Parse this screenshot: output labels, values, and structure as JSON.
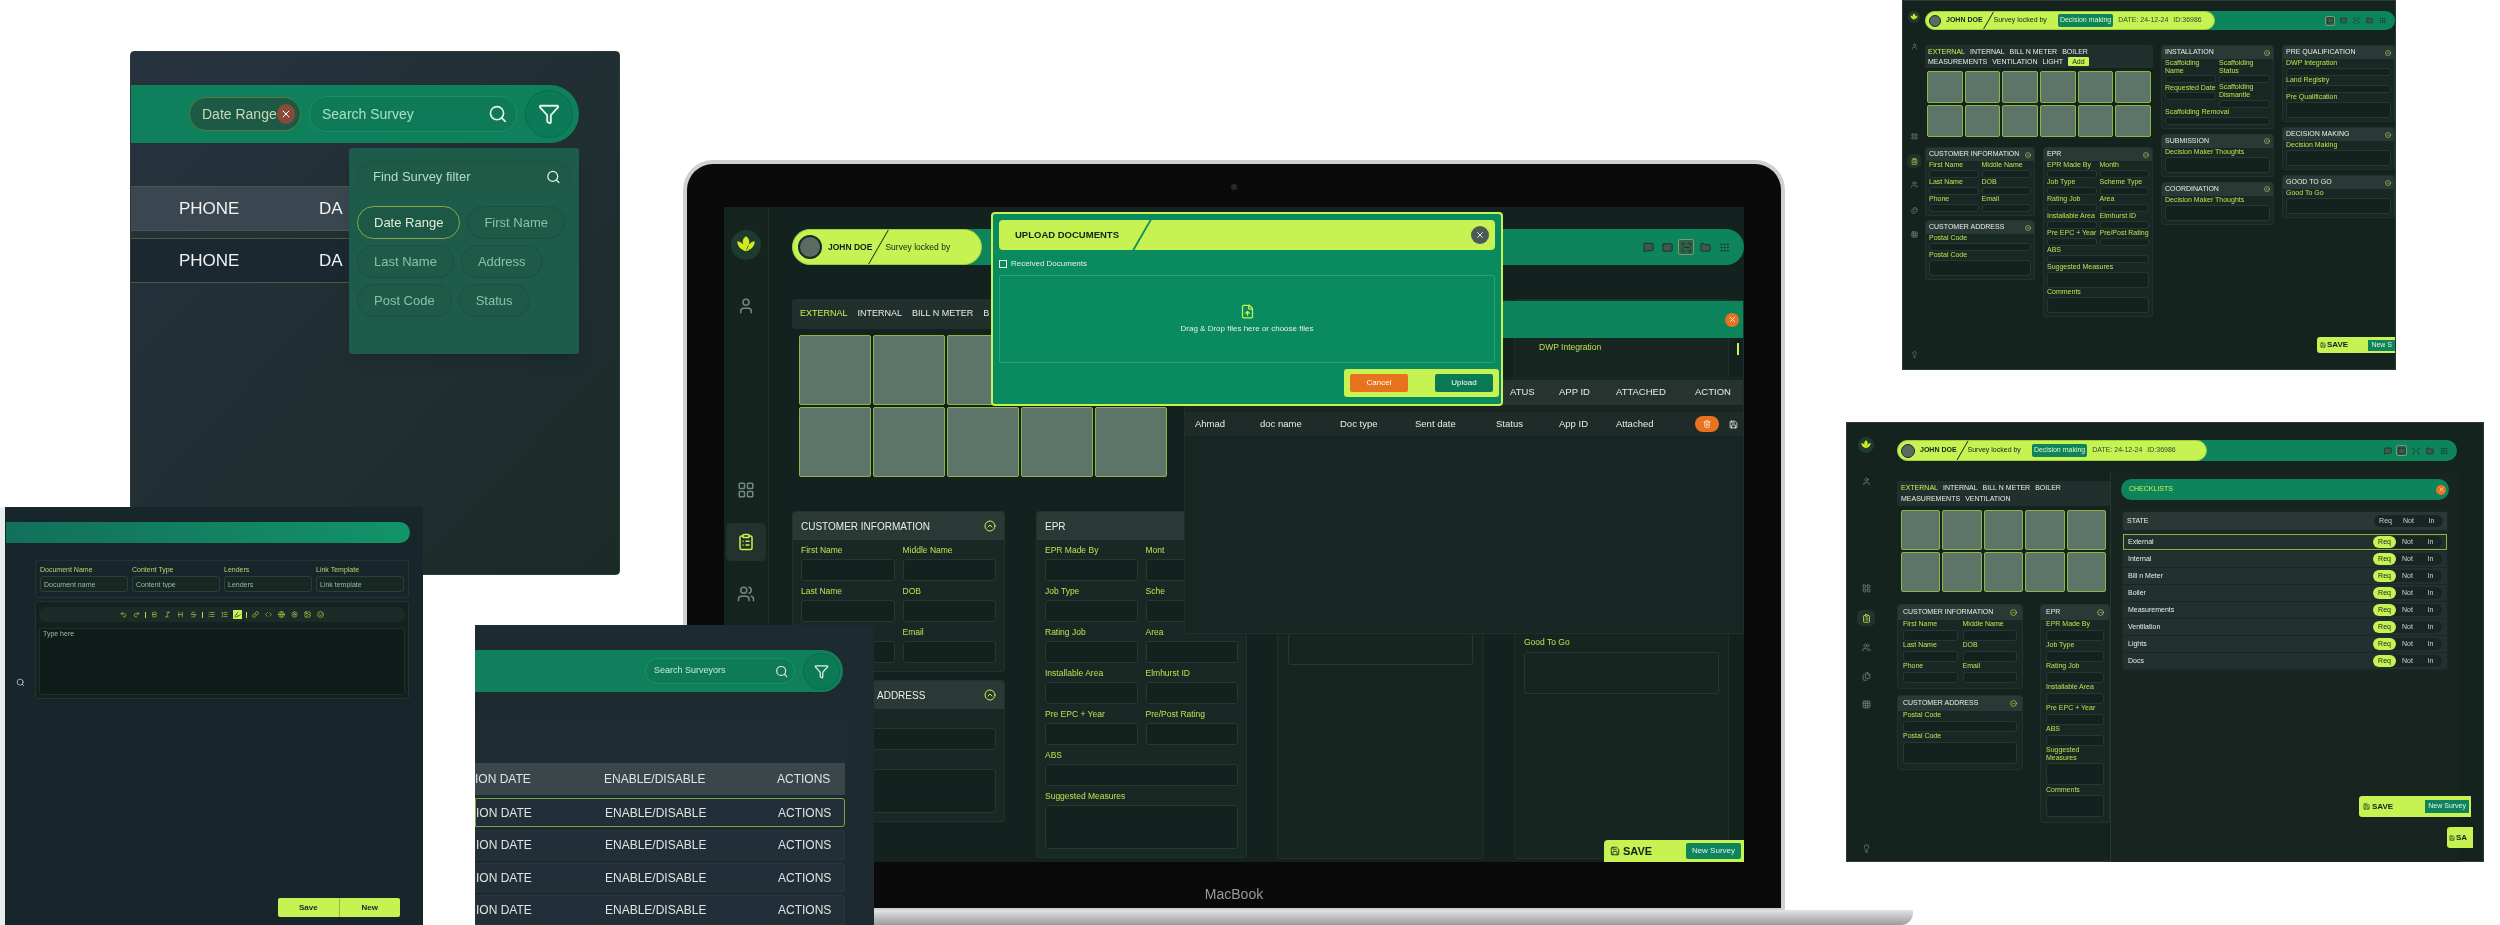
{
  "filter_panel": {
    "chip": "Date Range",
    "search": {
      "placeholder": "Search Survey"
    },
    "rows": [
      {
        "cells": [
          "PHONE",
          "DA"
        ],
        "selected": true
      },
      {
        "cells": [
          "PHONE",
          "DA"
        ],
        "selected": false
      }
    ],
    "dropdown": {
      "search": {
        "placeholder": "Find Survey filter"
      },
      "options": [
        {
          "label": "Date Range",
          "selected": true
        },
        {
          "label": "First Name",
          "selected": false
        },
        {
          "label": "Last Name",
          "selected": false
        },
        {
          "label": "Address",
          "selected": false
        },
        {
          "label": "Post Code",
          "selected": false
        },
        {
          "label": "Status",
          "selected": false
        }
      ]
    }
  },
  "template_panel": {
    "fields": [
      {
        "label": "Document Name",
        "placeholder": "Document name"
      },
      {
        "label": "Content Type",
        "placeholder": "Content type"
      },
      {
        "label": "Lenders",
        "placeholder": "Lenders"
      },
      {
        "label": "Link Template",
        "placeholder": "Link template"
      }
    ],
    "toolbar": [
      {
        "kind": "undo",
        "active": false
      },
      {
        "kind": "redo",
        "active": false
      },
      {
        "kind": "divider"
      },
      {
        "kind": "bold",
        "active": false
      },
      {
        "kind": "italic",
        "active": false
      },
      {
        "kind": "heading",
        "active": false
      },
      {
        "kind": "strike",
        "active": false
      },
      {
        "kind": "divider"
      },
      {
        "kind": "list",
        "active": false
      },
      {
        "kind": "ordered",
        "active": false
      },
      {
        "kind": "highlight",
        "active": true
      },
      {
        "kind": "divider"
      },
      {
        "kind": "link",
        "active": false
      },
      {
        "kind": "code",
        "active": false
      },
      {
        "kind": "globe",
        "active": false
      },
      {
        "kind": "settings",
        "active": false
      },
      {
        "kind": "image",
        "active": false
      },
      {
        "kind": "smile",
        "active": false
      }
    ],
    "editor": {
      "placeholder": "Type here"
    },
    "buttons": [
      "Save",
      "New"
    ]
  },
  "laptop": {
    "brand": "MacBook",
    "screen": {
      "nav": [
        {
          "kind": "user",
          "selected": false
        },
        {
          "kind": "grid",
          "selected": false
        },
        {
          "kind": "clipboard",
          "selected": true
        },
        {
          "kind": "users",
          "selected": false
        }
      ],
      "header": {
        "user": "JOHN DOE",
        "lock_text": "Survey locked by",
        "icons": [
          {
            "kind": "note",
            "selected": false
          },
          {
            "kind": "mail",
            "selected": false
          },
          {
            "kind": "scan",
            "selected": true
          },
          {
            "kind": "folder",
            "selected": false
          },
          {
            "kind": "apps",
            "selected": false
          }
        ]
      },
      "tabs": [
        {
          "label": "EXTERNAL",
          "selected": true
        },
        {
          "label": "INTERNAL",
          "selected": false
        },
        {
          "label": "BILL N METER",
          "selected": false
        },
        {
          "label": "B",
          "selected": false
        }
      ],
      "customer_information": {
        "title": "CUSTOMER INFORMATION",
        "rows": [
          {
            "labels": [
              "First Name",
              "Middle Name"
            ],
            "tall": false
          },
          {
            "labels": [
              "Last Name",
              "DOB"
            ],
            "tall": false
          },
          {
            "labels": [
              "Email"
            ],
            "offset": true,
            "tall": false
          }
        ]
      },
      "customer_address": {
        "title": "ADDRESS",
        "rows": [
          {
            "tall": false
          },
          {
            "tall": true
          }
        ]
      },
      "epr": {
        "title": "EPR",
        "rows": [
          {
            "labels": [
              "EPR Made By",
              "Mont"
            ],
            "tall": false
          },
          {
            "labels": [
              "Job Type",
              "Sche"
            ],
            "tall": false
          },
          {
            "labels": [
              "Rating Job",
              "Area"
            ],
            "tall": false
          },
          {
            "labels": [
              "Installable Area",
              "Elmhurst ID"
            ],
            "tall": false
          },
          {
            "labels": [
              "Pre EPC + Year",
              "Pre/Post Rating"
            ],
            "tall": false
          },
          {
            "labels": [
              "ABS"
            ],
            "tall": false
          },
          {
            "labels": [
              "Suggested Measures"
            ],
            "tall": true
          }
        ]
      },
      "good_to_go": {
        "label": "Good To Go"
      },
      "documents": {
        "caption": "DWP Integration",
        "columns": [
          "",
          "",
          "",
          "",
          "ATUS",
          "APP ID",
          "ATTACHED",
          "ACTION"
        ],
        "rows": [
          {
            "cells": [
              "Ahmad",
              "doc name",
              "Doc type",
              "Sent date",
              "Status",
              "App ID",
              "Attached"
            ]
          }
        ]
      },
      "upload_dialog": {
        "title": "UPLOAD DOCUMENTS",
        "checkbox": {
          "label": "Received Documents",
          "checked": false
        },
        "drop_text": "Drag & Drop files here or choose files",
        "buttons": [
          {
            "label": "Cancel",
            "kind": "cancel"
          },
          {
            "label": "Upload",
            "kind": "confirm"
          }
        ]
      },
      "save_label": "SAVE",
      "new_label": "New Survey"
    }
  },
  "surveyors_panel": {
    "search": {
      "placeholder": "Search Surveyors"
    },
    "header": [
      "ION DATE",
      "ENABLE/DISABLE",
      "ACTIONS"
    ],
    "rows": [
      {
        "cells": [
          "ION DATE",
          "ENABLE/DISABLE",
          "ACTIONS"
        ],
        "selected": true
      },
      {
        "cells": [
          "ION DATE",
          "ENABLE/DISABLE",
          "ACTIONS"
        ],
        "selected": false
      },
      {
        "cells": [
          "ION DATE",
          "ENABLE/DISABLE",
          "ACTIONS"
        ],
        "selected": false
      },
      {
        "cells": [
          "ION DATE",
          "ENABLE/DISABLE",
          "ACTIONS"
        ],
        "selected": false
      }
    ]
  },
  "survey_overview": {
    "nav": [
      {
        "kind": "user",
        "selected": false
      },
      {
        "kind": "grid",
        "selected": false
      },
      {
        "kind": "clipboard",
        "selected": true
      },
      {
        "kind": "users",
        "selected": false
      },
      {
        "kind": "documents",
        "selected": false
      },
      {
        "kind": "apps",
        "selected": false
      },
      {
        "kind": "bulb",
        "selected": false
      }
    ],
    "header": {
      "user": "JOHN DOE",
      "lock_text": "Survey locked by",
      "status": "Decision making",
      "date": "DATE: 24-12-24",
      "id": "ID:36986",
      "icons": [
        {
          "kind": "note",
          "selected": true
        },
        {
          "kind": "mail",
          "selected": false
        },
        {
          "kind": "scan",
          "selected": false
        },
        {
          "kind": "folder",
          "selected": false
        },
        {
          "kind": "apps",
          "selected": false
        }
      ]
    },
    "tabs": [
      {
        "label": "EXTERNAL",
        "selected": true
      },
      {
        "label": "INTERNAL",
        "selected": false
      },
      {
        "label": "BILL N METER",
        "selected": false
      },
      {
        "label": "BOILER",
        "selected": false
      },
      {
        "label": "MEASUREMENTS",
        "selected": false
      },
      {
        "label": "VENTILATION",
        "selected": false
      },
      {
        "label": "LIGHT",
        "selected": false
      }
    ],
    "add_label": "Add",
    "columns": [
      [
        {
          "title": "CUSTOMER INFORMATION",
          "rows": [
            {
              "labels": [
                "First Name",
                "Middle Name"
              ],
              "tall": false
            },
            {
              "labels": [
                "Last Name",
                "DOB"
              ],
              "tall": false
            },
            {
              "labels": [
                "Phone",
                "Email"
              ],
              "tall": false
            }
          ]
        },
        {
          "title": "CUSTOMER ADDRESS",
          "rows": [
            {
              "labels": [
                "Postal Code"
              ],
              "tall": false
            },
            {
              "labels": [
                "Postal Code"
              ],
              "tall": true
            }
          ]
        }
      ],
      [
        {
          "title": "EPR",
          "rows": [
            {
              "labels": [
                "EPR Made By",
                "Month"
              ],
              "tall": false
            },
            {
              "labels": [
                "Job Type",
                "Scheme Type"
              ],
              "tall": false
            },
            {
              "labels": [
                "Rating Job",
                "Area"
              ],
              "tall": false
            },
            {
              "labels": [
                "Installable Area",
                "Elmhurst ID"
              ],
              "tall": false
            },
            {
              "labels": [
                "Pre EPC + Year",
                "Pre/Post Rating"
              ],
              "tall": false
            },
            {
              "labels": [
                "ABS"
              ],
              "tall": false
            },
            {
              "labels": [
                "Suggested Measures"
              ],
              "tall": true
            },
            {
              "labels": [
                "Comments"
              ],
              "tall": true
            }
          ]
        }
      ],
      [
        {
          "title": "INSTALLATION",
          "rows": [
            {
              "labels": [
                "Scaffolding Name",
                "Scaffolding Status"
              ],
              "tall": false
            },
            {
              "labels": [
                "Requested Date",
                "Scaffolding Dismantle"
              ],
              "tall": false
            },
            {
              "labels": [
                "Scaffolding Removal"
              ],
              "tall": false
            }
          ]
        },
        {
          "title": "SUBMISSION",
          "rows": [
            {
              "labels": [
                "Decision Maker Thoughts"
              ],
              "tall": true
            }
          ]
        },
        {
          "title": "COORDINATION",
          "rows": [
            {
              "labels": [
                "Decision Maker Thoughts"
              ],
              "tall": true
            }
          ]
        }
      ],
      [
        {
          "title": "PRE QUALIFICATION",
          "rows": [
            {
              "labels": [
                "DWP Integration"
              ],
              "tall": false
            },
            {
              "labels": [
                "Land Registry"
              ],
              "tall": false
            },
            {
              "labels": [
                "Pre Qualification"
              ],
              "tall": true
            }
          ]
        },
        {
          "title": "DECISION MAKING",
          "rows": [
            {
              "labels": [
                "Decision Making"
              ],
              "tall": true
            }
          ]
        },
        {
          "title": "GOOD TO GO",
          "rows": [
            {
              "labels": [
                "Good To Go"
              ],
              "tall": true
            }
          ]
        }
      ]
    ],
    "save_label": "SAVE",
    "new_label": "New S"
  },
  "checklist_screen": {
    "nav": [
      {
        "kind": "user",
        "selected": false
      },
      {
        "kind": "grid",
        "selected": false
      },
      {
        "kind": "clipboard",
        "selected": true
      },
      {
        "kind": "users",
        "selected": false
      },
      {
        "kind": "documents",
        "selected": false
      },
      {
        "kind": "apps",
        "selected": false
      },
      {
        "kind": "bulb",
        "selected": false
      }
    ],
    "header": {
      "user": "JOHN DOE",
      "lock_text": "Survey locked by",
      "status": "Decision making",
      "date": "DATE: 24-12-24",
      "id": "ID:36986",
      "icons": [
        {
          "kind": "note",
          "selected": false
        },
        {
          "kind": "mail",
          "selected": true
        },
        {
          "kind": "scan",
          "selected": false
        },
        {
          "kind": "folder",
          "selected": false
        },
        {
          "kind": "apps",
          "selected": false
        }
      ]
    },
    "tabs": [
      {
        "label": "EXTERNAL",
        "selected": true
      },
      {
        "label": "INTERNAL",
        "selected": false
      },
      {
        "label": "BILL N METER",
        "selected": false
      },
      {
        "label": "BOILER",
        "selected": false
      },
      {
        "label": "MEASUREMENTS",
        "selected": false
      },
      {
        "label": "VENTILATION",
        "selected": false
      }
    ],
    "columns": [
      [
        {
          "title": "CUSTOMER INFORMATION",
          "rows": [
            {
              "labels": [
                "First Name",
                "Middle Name"
              ],
              "tall": false
            },
            {
              "labels": [
                "Last Name",
                "DOB"
              ],
              "tall": false
            },
            {
              "labels": [
                "Phone",
                "Email"
              ],
              "tall": false
            }
          ]
        },
        {
          "title": "CUSTOMER ADDRESS",
          "rows": [
            {
              "labels": [
                "Postal Code"
              ],
              "tall": false
            },
            {
              "labels": [
                "Postal Code"
              ],
              "tall": true
            }
          ]
        }
      ],
      [
        {
          "title": "EPR",
          "rows": [
            {
              "labels": [
                "EPR Made By"
              ],
              "tall": false
            },
            {
              "labels": [
                "Job Type"
              ],
              "tall": false
            },
            {
              "labels": [
                "Rating Job"
              ],
              "tall": false
            },
            {
              "labels": [
                "Installable Area"
              ],
              "tall": false
            },
            {
              "labels": [
                "Pre EPC + Year"
              ],
              "tall": false
            },
            {
              "labels": [
                "ABS"
              ],
              "tall": false
            },
            {
              "labels": [
                "Suggested Measures"
              ],
              "tall": true
            },
            {
              "labels": [
                "Comments"
              ],
              "tall": true
            }
          ]
        }
      ]
    ],
    "checklist": {
      "title": "CHECKLISTS",
      "state_row": {
        "label": "STATE",
        "options": [
          "Req",
          "Not",
          "In"
        ]
      },
      "rows": [
        {
          "label": "External",
          "selected": true,
          "options": [
            {
              "label": "Req",
              "selected": true
            },
            {
              "label": "Not",
              "selected": false
            },
            {
              "label": "In",
              "selected": false
            }
          ]
        },
        {
          "label": "Internal",
          "selected": false,
          "options": [
            {
              "label": "Req",
              "selected": true
            },
            {
              "label": "Not",
              "selected": false
            },
            {
              "label": "In",
              "selected": false
            }
          ]
        },
        {
          "label": "Bill n Meter",
          "selected": false,
          "options": [
            {
              "label": "Req",
              "selected": true
            },
            {
              "label": "Not",
              "selected": false
            },
            {
              "label": "In",
              "selected": false
            }
          ]
        },
        {
          "label": "Boiler",
          "selected": false,
          "options": [
            {
              "label": "Req",
              "selected": true
            },
            {
              "label": "Not",
              "selected": false
            },
            {
              "label": "In",
              "selected": false
            }
          ]
        },
        {
          "label": "Measurements",
          "selected": false,
          "options": [
            {
              "label": "Req",
              "selected": true
            },
            {
              "label": "Not",
              "selected": false
            },
            {
              "label": "In",
              "selected": false
            }
          ]
        },
        {
          "label": "Ventilation",
          "selected": false,
          "options": [
            {
              "label": "Req",
              "selected": true
            },
            {
              "label": "Not",
              "selected": false
            },
            {
              "label": "In",
              "selected": false
            }
          ]
        },
        {
          "label": "Lights",
          "selected": false,
          "options": [
            {
              "label": "Req",
              "selected": true
            },
            {
              "label": "Not",
              "selected": false
            },
            {
              "label": "In",
              "selected": false
            }
          ]
        },
        {
          "label": "Docs",
          "selected": false,
          "options": [
            {
              "label": "Req",
              "selected": true
            },
            {
              "label": "Not",
              "selected": false
            },
            {
              "label": "In",
              "selected": false
            }
          ]
        }
      ]
    },
    "save_label": "SAVE",
    "new_label": "New Survey",
    "second_save_label": "SA"
  }
}
